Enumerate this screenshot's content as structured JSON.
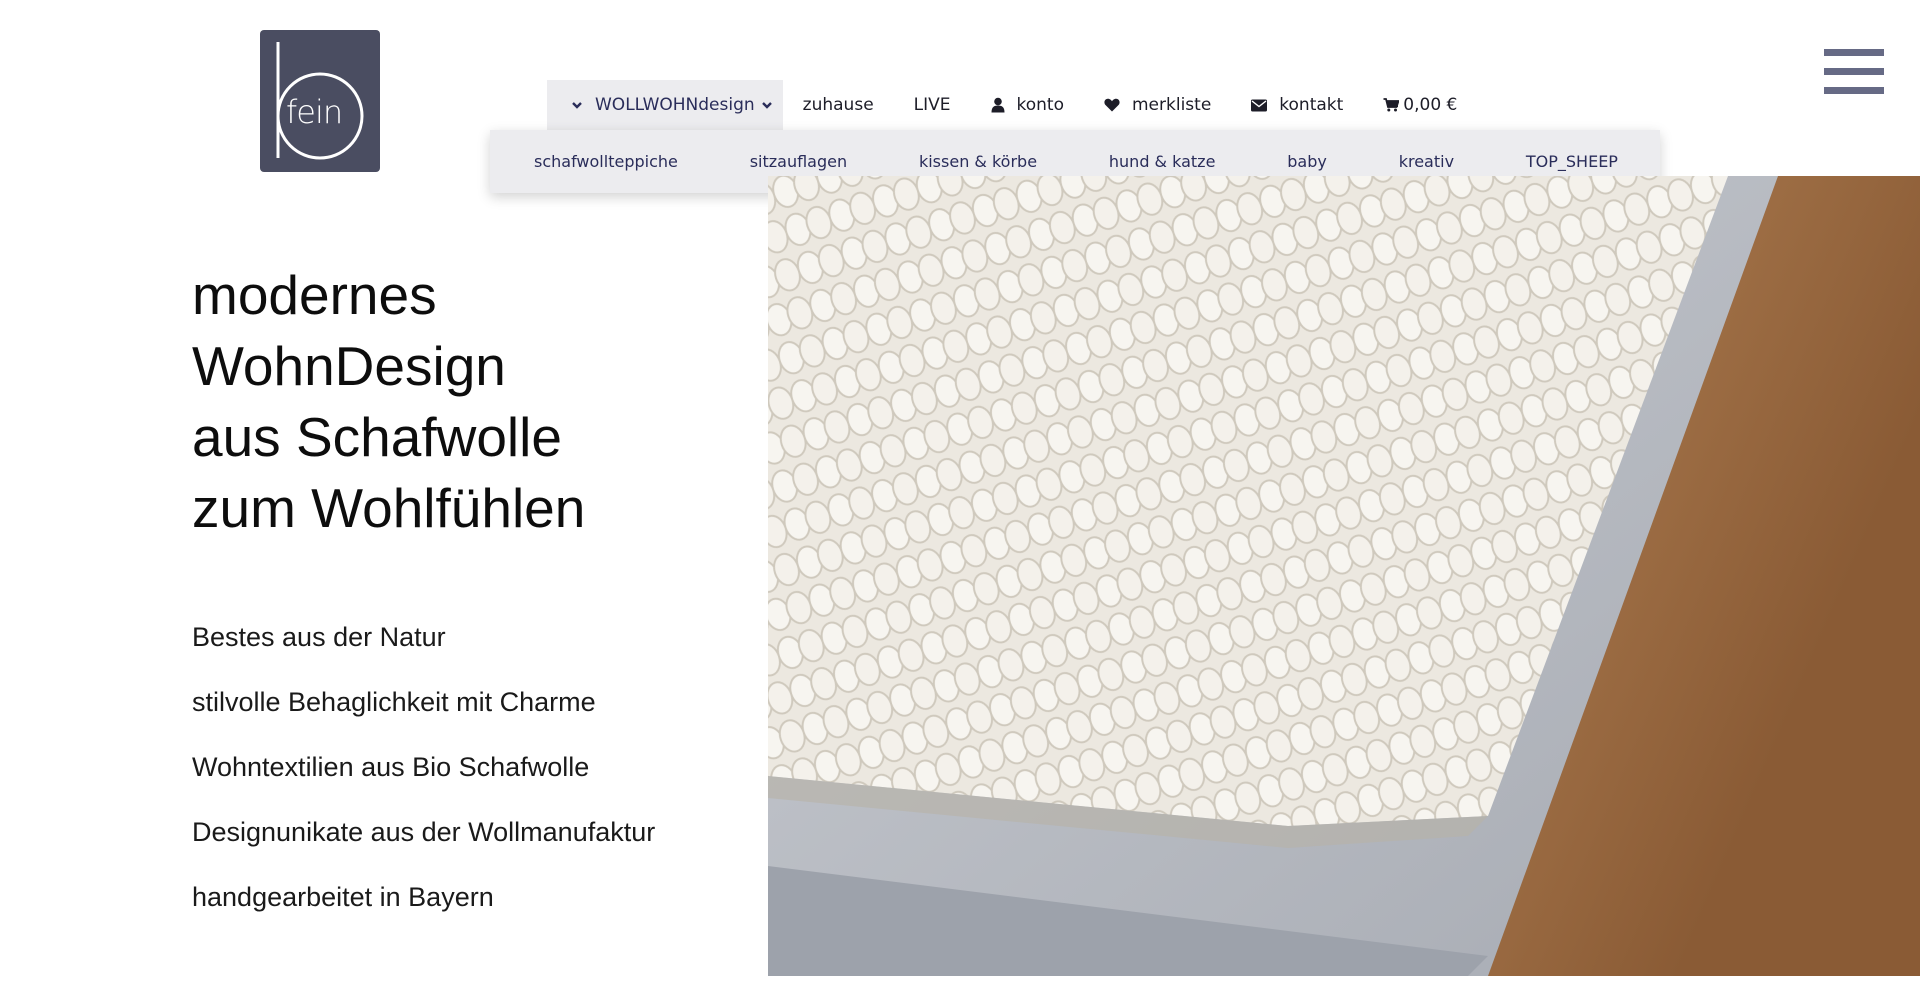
{
  "logo": {
    "text": "fein"
  },
  "topnav": {
    "items": [
      {
        "label": "WOLLWOHNdesign",
        "icon": "chevron-down-icon"
      },
      {
        "label": "zuhause"
      },
      {
        "label": "LIVE"
      },
      {
        "label": "konto",
        "icon": "user-icon"
      },
      {
        "label": "merkliste",
        "icon": "heart-icon"
      },
      {
        "label": "kontakt",
        "icon": "envelope-icon"
      },
      {
        "label": "0,00 €",
        "icon": "cart-icon"
      }
    ]
  },
  "submenu": {
    "items": [
      "schafwollteppiche",
      "sitzauflagen",
      "kissen & körbe",
      "hund & katze",
      "baby",
      "kreativ",
      "TOP_SHEEP"
    ]
  },
  "hero": {
    "headline": [
      "modernes",
      "WohnDesign",
      "aus Schafwolle",
      "zum Wohlfühlen"
    ],
    "features": [
      "Bestes aus der Natur",
      "stilvolle Behaglichkeit mit Charme",
      "Wohntextilien aus Bio Schafwolle",
      "Designunikate aus der Wollmanufaktur",
      "handgearbeitet in Bayern"
    ]
  },
  "colors": {
    "logo_bg": "#4a4d61",
    "nav_text": "#1d1d28",
    "submenu_bg": "#ececef",
    "submenu_text": "#2a2d5a",
    "hamburger": "#666a85"
  }
}
